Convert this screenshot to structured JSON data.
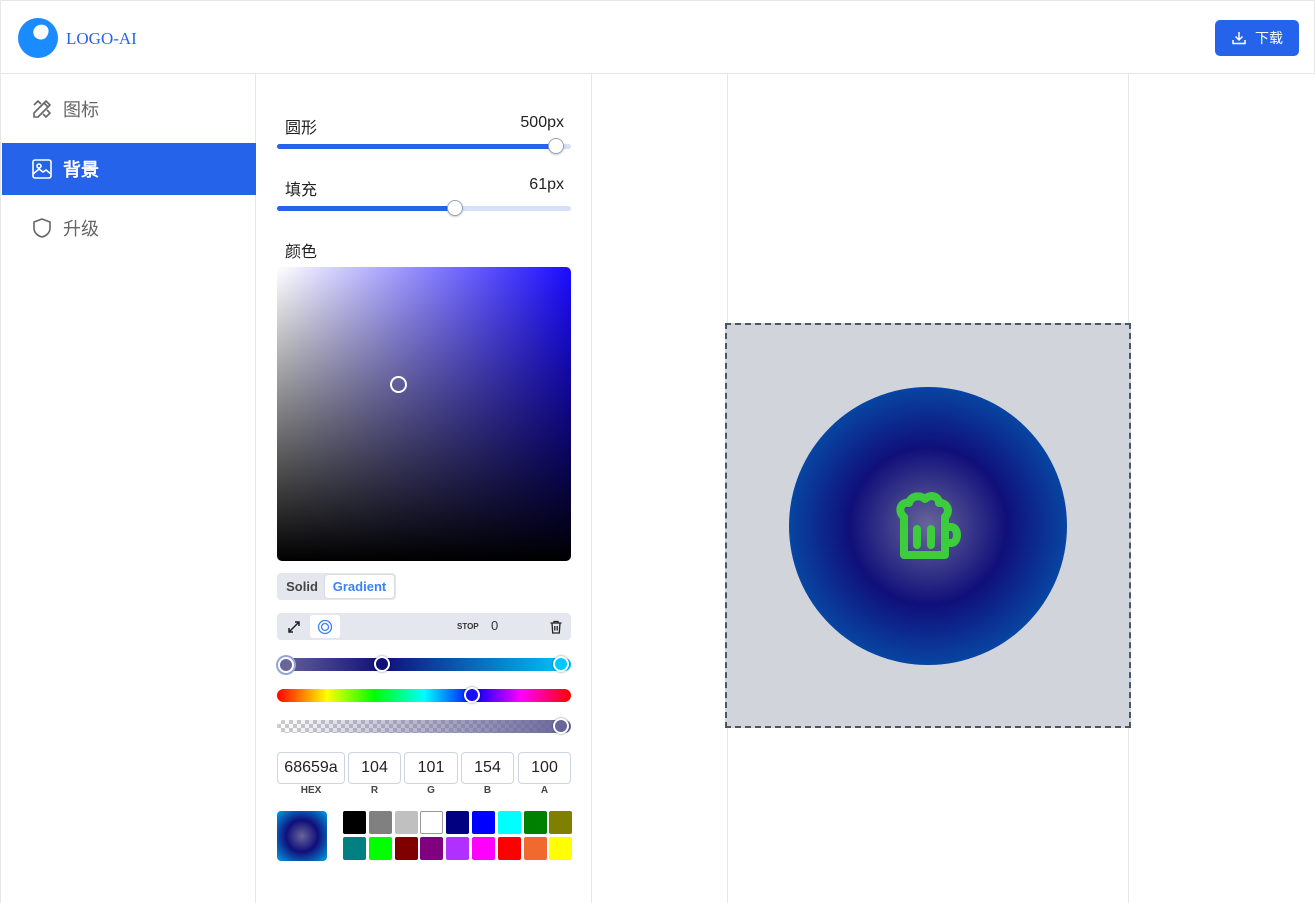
{
  "header": {
    "logo_text": "LOGO-AI",
    "download_label": "下载"
  },
  "sidebar": {
    "items": [
      {
        "label": "图标",
        "icon": "pencil-ruler-icon",
        "active": false
      },
      {
        "label": "背景",
        "icon": "image-icon",
        "active": true
      },
      {
        "label": "升级",
        "icon": "shield-icon",
        "active": false
      }
    ]
  },
  "panel": {
    "round": {
      "label": "圆形",
      "value": "500px",
      "fraction": 0.95
    },
    "padding": {
      "label": "填充",
      "value": "61px",
      "fraction": 0.6
    },
    "color_label": "颜色",
    "mode_tabs": {
      "solid": "Solid",
      "gradient": "Gradient",
      "selected": "Gradient"
    },
    "stop_label": "STOP",
    "stop_value": "0",
    "color": {
      "hex": "68659a",
      "r": "104",
      "g": "101",
      "b": "154",
      "a": "100"
    },
    "field_labels": {
      "hex": "HEX",
      "r": "R",
      "g": "G",
      "b": "B",
      "a": "A"
    },
    "gradient_stops": [
      "#68659a",
      "#100f7a",
      "#00c8ff"
    ],
    "swatches": [
      "#000000",
      "#808080",
      "#c0c0c0",
      "#ffffff",
      "#000080",
      "#0000ff",
      "#00ffff",
      "#008000",
      "#808000",
      "#008080",
      "#00ff00",
      "#800000",
      "#800080",
      "#b030ff",
      "#ff00ff",
      "#ff0000",
      "#f06a30",
      "#ffff00"
    ]
  },
  "canvas": {
    "icon": "beer-mug-icon",
    "icon_color": "#3ccc3c",
    "background_color": "#d1d5db"
  }
}
